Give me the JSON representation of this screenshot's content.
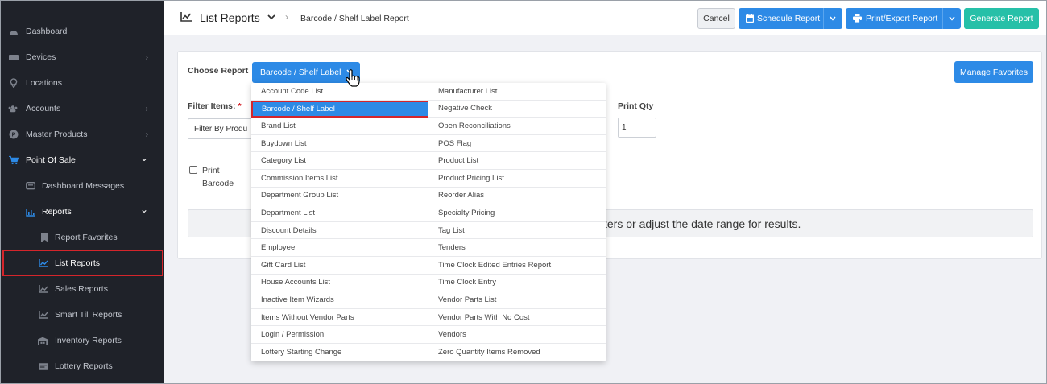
{
  "sidebar": {
    "items": [
      {
        "label": "Dashboard",
        "icon": "dashboard-icon",
        "chevron": ""
      },
      {
        "label": "Devices",
        "icon": "layers-icon",
        "chevron": "›"
      },
      {
        "label": "Locations",
        "icon": "location-pin-icon",
        "chevron": ""
      },
      {
        "label": "Accounts",
        "icon": "users-icon",
        "chevron": "›"
      },
      {
        "label": "Master Products",
        "icon": "product-p-icon",
        "chevron": "›"
      },
      {
        "label": "Point Of Sale",
        "icon": "cart-icon",
        "chevron": "⌄"
      }
    ],
    "sub_items": [
      {
        "label": "Dashboard Messages",
        "icon": "message-icon"
      },
      {
        "label": "Reports",
        "icon": "chart-icon",
        "chevron": "⌄"
      }
    ],
    "report_items": [
      {
        "label": "Report Favorites",
        "icon": "bookmark-icon"
      },
      {
        "label": "List Reports",
        "icon": "line-chart-icon"
      },
      {
        "label": "Sales Reports",
        "icon": "line-chart-icon"
      },
      {
        "label": "Smart Till Reports",
        "icon": "line-chart-icon"
      },
      {
        "label": "Inventory Reports",
        "icon": "warehouse-icon"
      },
      {
        "label": "Lottery Reports",
        "icon": "lottery-icon"
      }
    ]
  },
  "header": {
    "title": "List Reports",
    "breadcrumb_sep": "›",
    "breadcrumb": "Barcode / Shelf Label Report",
    "cancel": "Cancel",
    "schedule": "Schedule Report",
    "print_export": "Print/Export Report",
    "generate": "Generate Report"
  },
  "card": {
    "choose_report_label": "Choose Report",
    "selected_report": "Barcode / Shelf Label",
    "manage_favorites": "Manage Favorites",
    "filter_items_label": "Filter Items:",
    "required_mark": "*",
    "filter_by_placeholder": "Filter By Produ",
    "print_qty_label": "Print Qty",
    "print_qty_value": "1",
    "print_barcode_label_1": "Print",
    "print_barcode_label_2": "Barcode",
    "message": "ters or adjust the date range for results."
  },
  "dropdown": {
    "col1": [
      "Account Code List",
      "Barcode / Shelf Label",
      "Brand List",
      "Buydown List",
      "Category List",
      "Commission Items List",
      "Department Group List",
      "Department List",
      "Discount Details",
      "Employee",
      "Gift Card List",
      "House Accounts List",
      "Inactive Item Wizards",
      "Items Without Vendor Parts",
      "Login / Permission",
      "Lottery Starting Change"
    ],
    "col2": [
      "Manufacturer List",
      "Negative Check",
      "Open Reconciliations",
      "POS Flag",
      "Product List",
      "Product Pricing List",
      "Reorder Alias",
      "Specialty Pricing",
      "Tag List",
      "Tenders",
      "Time Clock Edited Entries Report",
      "Time Clock Entry",
      "Vendor Parts List",
      "Vendor Parts With No Cost",
      "Vendors",
      "Zero Quantity Items Removed"
    ],
    "selected": "Barcode / Shelf Label"
  },
  "colors": {
    "primary": "#2d8ae6",
    "teal": "#26c0a8",
    "sidebar": "#1f2229",
    "highlight": "#d4252b"
  }
}
